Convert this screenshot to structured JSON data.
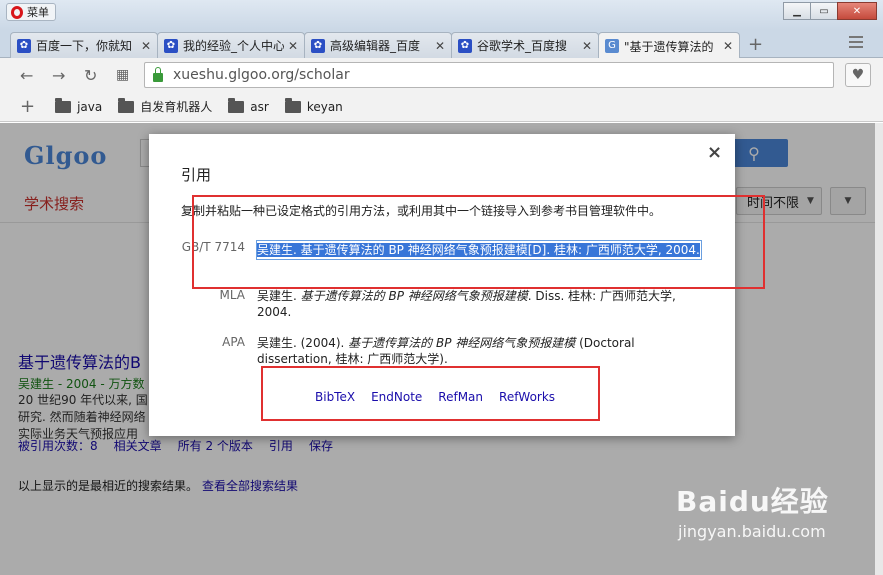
{
  "browser": {
    "menu_label": "菜单",
    "tabs": [
      {
        "title": "百度一下，你就知"
      },
      {
        "title": "我的经验_个人中心"
      },
      {
        "title": "高级编辑器_百度"
      },
      {
        "title": "谷歌学术_百度搜"
      },
      {
        "title": "\"基于遗传算法的"
      }
    ],
    "url": "xueshu.glgoo.org/scholar",
    "bookmarks": [
      "java",
      "自发育机器人",
      "asr",
      "keyan"
    ]
  },
  "page": {
    "logo": "Glgoo",
    "scholar_link": "学术搜索",
    "time_filter": "时间不限",
    "result": {
      "title": "基于遗传算法的B",
      "meta": "吴建生 - 2004 - 万方数",
      "snippet": [
        "20 世纪90 年代以来, 国",
        "研究. 然而随着神经网络",
        "实际业务天气预报应用"
      ],
      "links": [
        "被引用次数：8",
        "相关文章",
        "所有 2 个版本",
        "引用",
        "保存"
      ]
    },
    "footer_text": "以上显示的是最相近的搜索结果。",
    "footer_link": "查看全部搜索结果"
  },
  "dialog": {
    "title": "引用",
    "close": "×",
    "instructions": "复制并粘贴一种已设定格式的引用方法，或利用其中一个链接导入到参考书目管理软件中。",
    "citations": [
      {
        "label": "GB/T 7714",
        "text": "吴建生. 基于遗传算法的 BP 神经网络气象预报建模[D]. 桂林: 广西师范大学, 2004."
      },
      {
        "label": "MLA",
        "pre": "吴建生. ",
        "italic": "基于遗传算法的 BP 神经网络气象预报建模",
        "post": ". Diss. 桂林: 广西师范大学, 2004."
      },
      {
        "label": "APA",
        "pre": "吴建生. (2004). ",
        "italic": "基于遗传算法的 BP 神经网络气象预报建模",
        "post": " (Doctoral dissertation, 桂林: 广西师范大学)."
      }
    ],
    "exports": [
      "BibTeX",
      "EndNote",
      "RefMan",
      "RefWorks"
    ]
  },
  "watermark": {
    "logo": "Baidu经验",
    "url": "jingyan.baidu.com"
  },
  "colors": {
    "annotation_red": "#e03030",
    "selection_blue": "#3876d8",
    "link_blue": "#1a0dab"
  }
}
